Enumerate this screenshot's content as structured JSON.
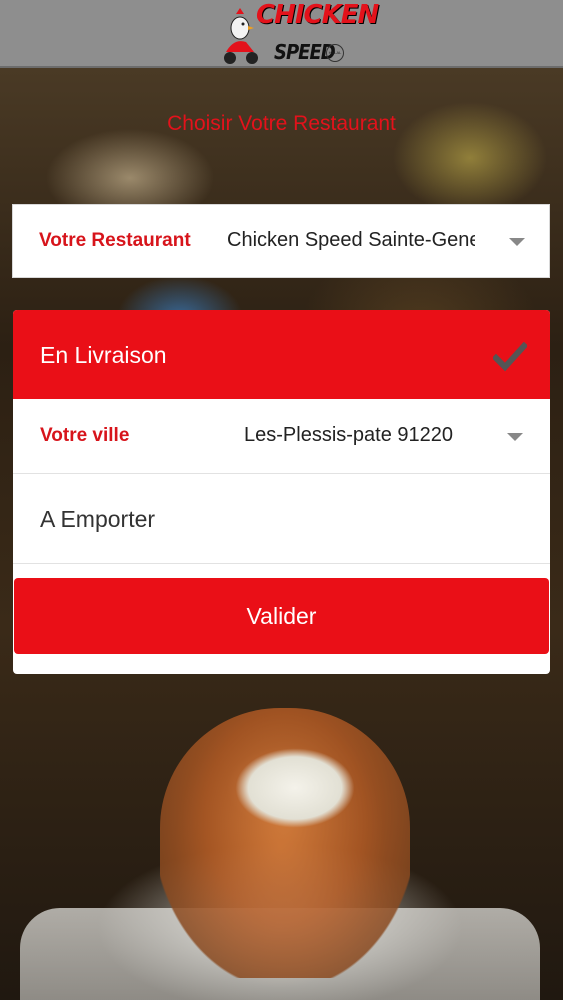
{
  "header": {
    "logo": {
      "line1": "CHICKEN",
      "line2": "SPEED",
      "badge": "HALAL"
    }
  },
  "page_title": "Choisir Votre Restaurant",
  "restaurant_select": {
    "label": "Votre Restaurant",
    "value": "Chicken Speed Sainte-Geneviève"
  },
  "delivery": {
    "livraison_label": "En Livraison",
    "livraison_selected": true,
    "city_label": "Votre ville",
    "city_value": "Les-Plessis-pate 91220",
    "emporter_label": "A Emporter",
    "submit_label": "Valider"
  },
  "colors": {
    "accent": "#ea0f17",
    "header_bg": "#8e8e8e"
  }
}
